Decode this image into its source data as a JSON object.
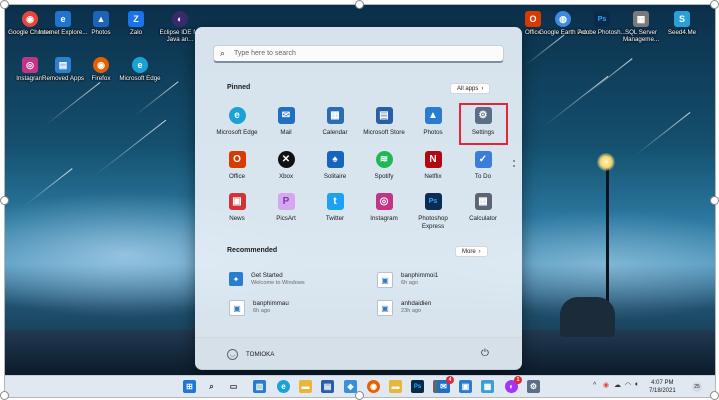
{
  "desktop": {
    "icons": [
      {
        "label": "Google Chrome",
        "icon": "chrome-icon",
        "color": "#e8453c"
      },
      {
        "label": "Internet Explore...",
        "icon": "internet-explorer-icon",
        "color": "#1e74d0"
      },
      {
        "label": "Photos",
        "icon": "photos-icon",
        "color": "#1d63b8"
      },
      {
        "label": "Zalo",
        "icon": "zalo-icon",
        "color": "#1a73e8"
      },
      {
        "label": "Eclipse IDE for Java an...",
        "icon": "eclipse-icon",
        "color": "#3b2a6b"
      },
      {
        "label": "Instagram",
        "icon": "instagram-icon",
        "color": "#c13584"
      },
      {
        "label": "Removed Apps",
        "icon": "removed-apps-icon",
        "color": "#2f7fd0"
      },
      {
        "label": "Firefox",
        "icon": "firefox-icon",
        "color": "#e66000"
      },
      {
        "label": "Microsoft Edge",
        "icon": "edge-icon",
        "color": "#1aa2d6"
      },
      {
        "label": "Office",
        "icon": "office-icon",
        "color": "#d83b01"
      },
      {
        "label": "Google Earth Pro",
        "icon": "google-earth-icon",
        "color": "#3c8be0"
      },
      {
        "label": "Adobe Photosh...",
        "icon": "photoshop-icon",
        "color": "#0a2a4a"
      },
      {
        "label": "SQL Server Manageme...",
        "icon": "sql-server-icon",
        "color": "#7a7a7a"
      },
      {
        "label": "Seed4.Me",
        "icon": "seed4me-icon",
        "color": "#2aa0d8"
      }
    ]
  },
  "start_menu": {
    "search_placeholder": "Type here to search",
    "pinned_title": "Pinned",
    "all_apps_label": "All apps",
    "pinned": [
      {
        "name": "Microsoft Edge",
        "icon": "edge-icon",
        "color": "#1aa2d6",
        "glyph": "e"
      },
      {
        "name": "Mail",
        "icon": "mail-icon",
        "color": "#1f6fc5",
        "glyph": "✉"
      },
      {
        "name": "Calendar",
        "icon": "calendar-icon",
        "color": "#2b6cb8",
        "glyph": "▦"
      },
      {
        "name": "Microsoft Store",
        "icon": "store-icon",
        "color": "#2a5fa8",
        "glyph": "▤"
      },
      {
        "name": "Photos",
        "icon": "photos-icon",
        "color": "#2a7cd0",
        "glyph": "▲"
      },
      {
        "name": "Settings",
        "icon": "gear-icon",
        "color": "#5a6f86",
        "glyph": "⚙"
      },
      {
        "name": "Office",
        "icon": "office-icon",
        "color": "#d83b01",
        "glyph": "O"
      },
      {
        "name": "Xbox",
        "icon": "xbox-icon",
        "color": "#111111",
        "glyph": "✕"
      },
      {
        "name": "Solitaire",
        "icon": "solitaire-icon",
        "color": "#1565c0",
        "glyph": "♠"
      },
      {
        "name": "Spotify",
        "icon": "spotify-icon",
        "color": "#1db954",
        "glyph": "≋"
      },
      {
        "name": "Netflix",
        "icon": "netflix-icon",
        "color": "#b00710",
        "glyph": "N"
      },
      {
        "name": "To Do",
        "icon": "todo-icon",
        "color": "#3b7ddb",
        "glyph": "✓"
      },
      {
        "name": "News",
        "icon": "news-icon",
        "color": "#d13438",
        "glyph": "▣"
      },
      {
        "name": "PicsArt",
        "icon": "picsart-icon",
        "color": "#d7a6f0",
        "glyph": "P"
      },
      {
        "name": "Twitter",
        "icon": "twitter-icon",
        "color": "#1da1f2",
        "glyph": "t"
      },
      {
        "name": "Instagram",
        "icon": "instagram-icon",
        "color": "#c13584",
        "glyph": "◎"
      },
      {
        "name": "Photoshop Express",
        "icon": "photoshop-express-icon",
        "color": "#0b2c55",
        "glyph": "Ps"
      },
      {
        "name": "Calculator",
        "icon": "calculator-icon",
        "color": "#5b6573",
        "glyph": "▦"
      }
    ],
    "recommended_title": "Recommended",
    "more_label": "More",
    "recommended": [
      {
        "title": "Get Started",
        "subtitle": "Welcome to Windows",
        "icon": "get-started-icon",
        "color": "#2a7cd0"
      },
      {
        "title": "banphimmoi1",
        "subtitle": "6h ago",
        "icon": "image-file-icon",
        "color": "#3a78c8"
      },
      {
        "title": "banphimmau",
        "subtitle": "6h ago",
        "icon": "image-file-icon",
        "color": "#3a78c8"
      },
      {
        "title": "anhdaidien",
        "subtitle": "23h ago",
        "icon": "image-file-icon",
        "color": "#3a78c8"
      }
    ],
    "user_name": "TOMIOKA",
    "highlight_color": "#e0283a"
  },
  "taskbar": {
    "apps": [
      {
        "icon": "windows-start-icon",
        "color": "#1e78d7",
        "glyph": "⊞"
      },
      {
        "icon": "search-icon",
        "color": "#444444",
        "glyph": "⌕"
      },
      {
        "icon": "task-view-icon",
        "color": "#333333",
        "glyph": "▭"
      },
      {
        "icon": "widgets-icon",
        "color": "#2a7cd0",
        "glyph": "▥"
      },
      {
        "icon": "edge-icon",
        "color": "#1aa2d6",
        "glyph": "e"
      },
      {
        "icon": "file-explorer-icon",
        "color": "#e8b73a",
        "glyph": "▬"
      },
      {
        "icon": "store-icon",
        "color": "#2a5fa8",
        "glyph": "▤"
      },
      {
        "icon": "firefox-icon",
        "color": "#e66000",
        "glyph": "◉"
      },
      {
        "icon": "folder-icon",
        "color": "#e8b73a",
        "glyph": "▬"
      },
      {
        "icon": "photoshop-icon",
        "color": "#0a2a4a",
        "glyph": "Ps"
      },
      {
        "icon": "notes-icon",
        "color": "#666666",
        "glyph": "≡"
      },
      {
        "icon": "mail-icon",
        "color": "#1f6fc5",
        "glyph": "✉",
        "badge": "4"
      },
      {
        "icon": "store-bag-icon",
        "color": "#2a7cd0",
        "glyph": "▣"
      },
      {
        "icon": "gallery-icon",
        "color": "#3c9fd8",
        "glyph": "▦"
      },
      {
        "icon": "messenger-icon",
        "color": "#a334fa",
        "glyph": "◐",
        "badge": "1"
      },
      {
        "icon": "gear-icon",
        "color": "#5a6f86",
        "glyph": "⚙"
      }
    ],
    "tray": {
      "up_arrow": "^",
      "time": "4:07 PM",
      "date": "7/18/2021",
      "notification_count": "25"
    }
  }
}
